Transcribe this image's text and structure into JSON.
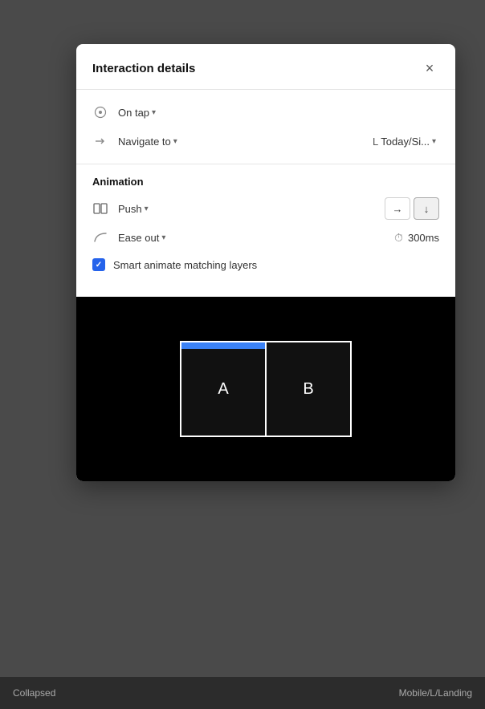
{
  "panel": {
    "title": "Interaction details",
    "close_label": "×"
  },
  "trigger": {
    "icon": "⊙",
    "label": "On tap",
    "chevron": "▾"
  },
  "action": {
    "arrow": "→",
    "label": "Navigate to",
    "chevron": "▾",
    "destination_prefix": "L",
    "destination_text": "Today/Si...",
    "destination_chevron": "▾"
  },
  "animation_section": {
    "title": "Animation",
    "push_label": "Push",
    "push_chevron": "▾",
    "direction_right": "→",
    "direction_down": "↓",
    "ease_label": "Ease out",
    "ease_chevron": "▾",
    "duration": "300ms",
    "smart_animate_label": "Smart animate matching layers",
    "preview_frame_a": "A",
    "preview_frame_b": "B"
  },
  "bottom_bar": {
    "left": "Collapsed",
    "right": "Mobile/L/Landing"
  }
}
